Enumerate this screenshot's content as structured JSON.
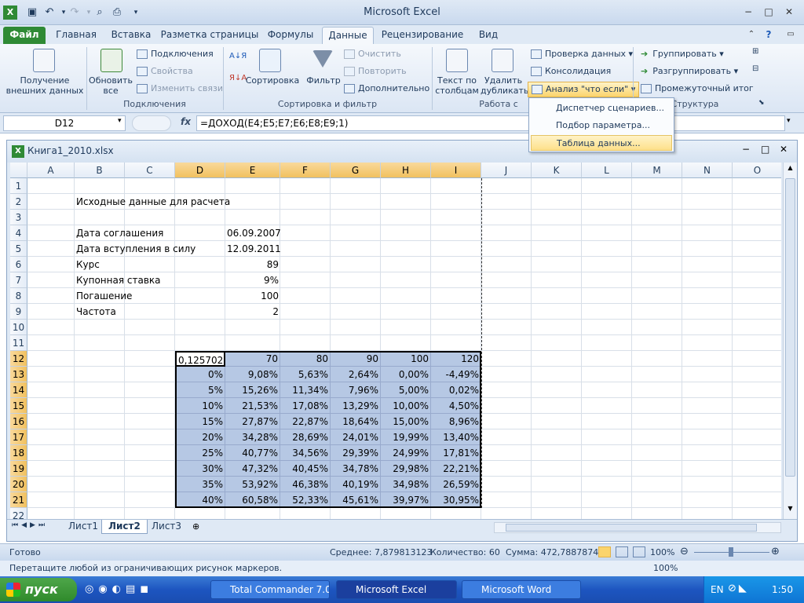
{
  "app": {
    "title": "Microsoft Excel"
  },
  "window_buttons": {
    "minimize": "−",
    "maximize": "□",
    "close": "✕",
    "help": "?"
  },
  "tabs": [
    {
      "label": "Файл"
    },
    {
      "label": "Главная"
    },
    {
      "label": "Вставка"
    },
    {
      "label": "Разметка страницы"
    },
    {
      "label": "Формулы"
    },
    {
      "label": "Данные"
    },
    {
      "label": "Рецензирование"
    },
    {
      "label": "Вид"
    }
  ],
  "ribbon": {
    "external_data": {
      "line1": "Получение",
      "line2": "внешних данных"
    },
    "refresh": {
      "line1": "Обновить",
      "line2": "все"
    },
    "connections": "Подключения",
    "properties": "Свойства",
    "edit_links": "Изменить связи",
    "group_connections": "Подключения",
    "sort": "Сортировка",
    "filter": "Фильтр",
    "clear": "Очистить",
    "reapply": "Повторить",
    "advanced": "Дополнительно",
    "group_sort": "Сортировка и фильтр",
    "text_to_cols": {
      "line1": "Текст по",
      "line2": "столбцам"
    },
    "remove_dupes": {
      "line1": "Удалить",
      "line2": "дубликаты"
    },
    "group_tools": "Работа с",
    "validation": "Проверка данных",
    "consolidate": "Консолидация",
    "whatif": "Анализ \"что если\"",
    "group_btn": "Группировать",
    "ungroup_btn": "Разгруппировать",
    "subtotal": "Промежуточный итог",
    "group_outline": "Структура",
    "sort_az": "А↓Я",
    "sort_za": "Я↓А"
  },
  "whatif_menu": [
    {
      "label": "Диспетчер сценариев..."
    },
    {
      "label": "Подбор параметра..."
    },
    {
      "label": "Таблица данных..."
    }
  ],
  "formula_bar": {
    "name_box": "D12",
    "fx": "fx",
    "formula": "=ДОХОД(E4;E5;E7;E6;E8;E9;1)"
  },
  "workbook": {
    "title": "Книга1_2010.xlsx"
  },
  "columns": [
    "A",
    "B",
    "C",
    "D",
    "E",
    "F",
    "G",
    "H",
    "I",
    "J",
    "K",
    "L",
    "M",
    "N",
    "O"
  ],
  "rows": [
    "1",
    "2",
    "3",
    "4",
    "5",
    "6",
    "7",
    "8",
    "9",
    "10",
    "11",
    "12",
    "13",
    "14",
    "15",
    "16",
    "17",
    "18",
    "19",
    "20",
    "21",
    "22"
  ],
  "sheet": {
    "B2": "Исходные данные для расчета",
    "B4": "Дата соглашения",
    "E4": "06.09.2007",
    "B5": "Дата вступления в силу",
    "E5": "12.09.2011",
    "B6": "Курс",
    "E6": "89",
    "B7": "Купонная ставка",
    "E7": "9%",
    "B8": "Погашение",
    "E8": "100",
    "B9": "Частота",
    "E9": "2"
  },
  "data_table": {
    "corner": "0,125702",
    "col_headers": [
      "70",
      "80",
      "90",
      "100",
      "120"
    ],
    "rows": [
      {
        "rate": "0%",
        "values": [
          "9,08%",
          "5,63%",
          "2,64%",
          "0,00%",
          "-4,49%"
        ]
      },
      {
        "rate": "5%",
        "values": [
          "15,26%",
          "11,34%",
          "7,96%",
          "5,00%",
          "0,02%"
        ]
      },
      {
        "rate": "10%",
        "values": [
          "21,53%",
          "17,08%",
          "13,29%",
          "10,00%",
          "4,50%"
        ]
      },
      {
        "rate": "15%",
        "values": [
          "27,87%",
          "22,87%",
          "18,64%",
          "15,00%",
          "8,96%"
        ]
      },
      {
        "rate": "20%",
        "values": [
          "34,28%",
          "28,69%",
          "24,01%",
          "19,99%",
          "13,40%"
        ]
      },
      {
        "rate": "25%",
        "values": [
          "40,77%",
          "34,56%",
          "29,39%",
          "24,99%",
          "17,81%"
        ]
      },
      {
        "rate": "30%",
        "values": [
          "47,32%",
          "40,45%",
          "34,78%",
          "29,98%",
          "22,21%"
        ]
      },
      {
        "rate": "35%",
        "values": [
          "53,92%",
          "46,38%",
          "40,19%",
          "34,98%",
          "26,59%"
        ]
      },
      {
        "rate": "40%",
        "values": [
          "60,58%",
          "52,33%",
          "45,61%",
          "39,97%",
          "30,95%"
        ]
      }
    ]
  },
  "sheet_tabs": [
    {
      "label": "Лист1"
    },
    {
      "label": "Лист2"
    },
    {
      "label": "Лист3"
    }
  ],
  "status": {
    "ready": "Готово",
    "average": "Среднее: 7,879813123",
    "count": "Количество: 60",
    "sum": "Сумма: 472,7887874",
    "zoom": "100%",
    "hint": "Перетащите любой из ограничивающих рисунок маркеров.",
    "zoom2": "100%"
  },
  "taskbar": {
    "start": "пуск",
    "buttons": [
      {
        "label": "Total Commander 7.0..."
      },
      {
        "label": "Microsoft Excel"
      },
      {
        "label": "Microsoft Word"
      }
    ],
    "lang": "EN",
    "clock": "1:50"
  },
  "colors": {
    "selection_fill": "#b6c8e4",
    "file_tab": "#2f8a35",
    "header_highlight": "#f1c15f"
  }
}
